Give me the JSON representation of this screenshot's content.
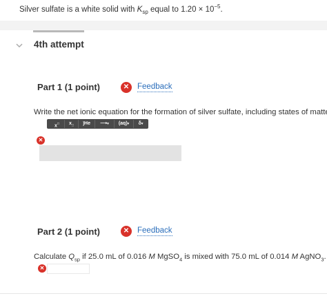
{
  "intro": {
    "prefix": "Silver sulfate is a white solid with ",
    "k": "K",
    "k_sub": "sp",
    "middle": " equal to 1.20 × 10",
    "exp": "−5",
    "suffix": "."
  },
  "attempt_label": "4th attempt",
  "part1": {
    "title": "Part 1   (1 point)",
    "feedback": "Feedback",
    "question": "Write the net ionic equation for the formation of silver sulfate, including states of matter.",
    "toolbar": [
      {
        "label": "x",
        "icon": "superscript-icon"
      },
      {
        "label": "x",
        "icon": "subscript-icon"
      },
      {
        "label": "He",
        "icon": "element-icon"
      },
      {
        "label": "⟶",
        "icon": "reaction-arrow-icon"
      },
      {
        "label": "(aq)",
        "icon": "state-icon"
      },
      {
        "label": "δ",
        "icon": "delta-icon"
      }
    ]
  },
  "part2": {
    "title": "Part 2   (1 point)",
    "feedback": "Feedback",
    "q_prefix": "Calculate ",
    "q": "Q",
    "q_sub": "sp",
    "q_mid1": " if 25.0 mL of 0.016 ",
    "m1": "M",
    "q_mid2": " MgSO",
    "so4_sub": "4",
    "q_mid3": " is mixed with 75.0 mL of 0.014 ",
    "m2": "M",
    "q_mid4": " AgNO",
    "no3_sub": "3",
    "q_end": "."
  },
  "colors": {
    "error_red": "#d9322a",
    "link_blue": "#2a6ebb"
  }
}
